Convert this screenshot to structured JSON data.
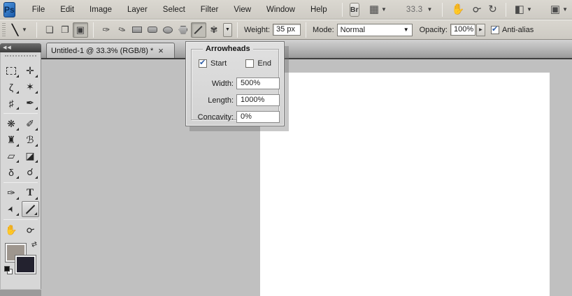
{
  "app": {
    "logo": "Ps"
  },
  "menu_bar": {
    "items": [
      "File",
      "Edit",
      "Image",
      "Layer",
      "Select",
      "Filter",
      "View",
      "Window",
      "Help"
    ],
    "bridge_label": "Br",
    "zoom_level": "33.3",
    "dropdown_glyph": "▼"
  },
  "icons": {
    "view_extras": "▦",
    "hand": "✋",
    "zoom": "☌",
    "rotate_view": "↻",
    "arrange_documents": "◧",
    "screen_mode": "▣",
    "line_preset": "╲",
    "shape_layers": "❏",
    "paths": "❐",
    "fill_pixels": "▣",
    "pen": "✑",
    "freeform_pen": "✑",
    "custom_shape": "✾",
    "geometry_arrow": "▼",
    "spinner_arrow": "▶",
    "check": "✔",
    "swap_colors": "⇄",
    "collapse": "◀◀"
  },
  "options_bar": {
    "weight_label": "Weight:",
    "weight_value": "35 px",
    "mode_label": "Mode:",
    "mode_value": "Normal",
    "opacity_label": "Opacity:",
    "opacity_value": "100%",
    "antialias_label": "Anti-alias"
  },
  "arrowheads_panel": {
    "title": "Arrowheads",
    "start_label": "Start",
    "end_label": "End",
    "width_label": "Width:",
    "width_value": "500%",
    "length_label": "Length:",
    "length_value": "1000%",
    "concavity_label": "Concavity:",
    "concavity_value": "0%"
  },
  "document": {
    "tab_title": "Untitled-1 @ 33.3% (RGB/8) *",
    "close_glyph": "×"
  },
  "toolbar": {
    "tools": [
      {
        "name": "rectangular-marquee",
        "glyph": ""
      },
      {
        "name": "move",
        "glyph": "✛"
      },
      {
        "name": "lasso",
        "glyph": "ζ"
      },
      {
        "name": "magic-wand",
        "glyph": "✶"
      },
      {
        "name": "crop",
        "glyph": "♯"
      },
      {
        "name": "eyedropper",
        "glyph": "✒"
      },
      {
        "name": "spot-healing-brush",
        "glyph": "❋"
      },
      {
        "name": "brush",
        "glyph": "✐"
      },
      {
        "name": "clone-stamp",
        "glyph": "♜"
      },
      {
        "name": "history-brush",
        "glyph": "ℬ"
      },
      {
        "name": "eraser",
        "glyph": "▱"
      },
      {
        "name": "paint-bucket",
        "glyph": "◪"
      },
      {
        "name": "blur",
        "glyph": "δ"
      },
      {
        "name": "dodge",
        "glyph": "☌"
      },
      {
        "name": "pen",
        "glyph": "✑"
      },
      {
        "name": "type",
        "glyph": "T"
      },
      {
        "name": "path-selection",
        "glyph": "➤"
      },
      {
        "name": "line",
        "glyph": ""
      },
      {
        "name": "hand",
        "glyph": "✋"
      },
      {
        "name": "zoom",
        "glyph": "☌"
      }
    ]
  },
  "colors": {
    "foreground": "#9e968e",
    "background": "#23222f",
    "canvas": "#c0c0c0",
    "accent_check": "#2e5da6"
  }
}
